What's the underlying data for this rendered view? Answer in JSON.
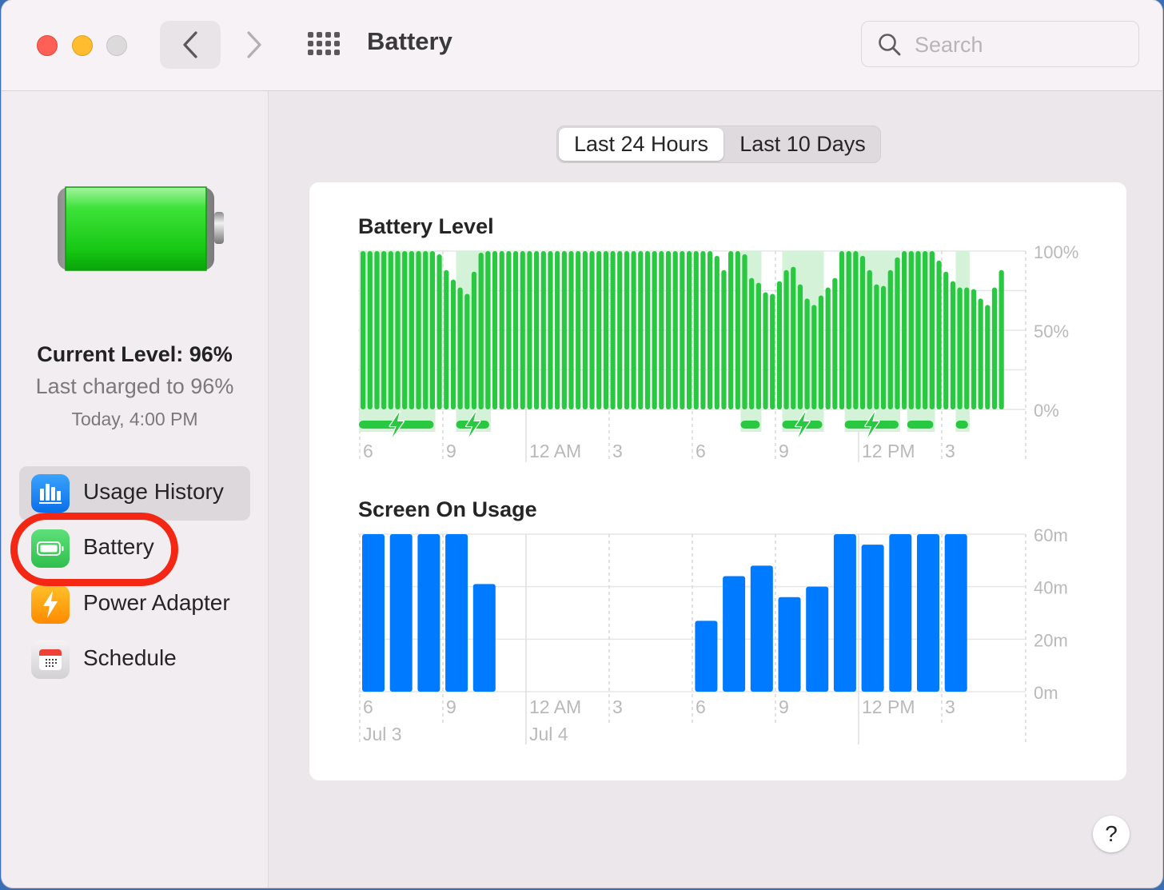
{
  "window": {
    "title": "Battery",
    "search_placeholder": "Search",
    "traffic_lights": [
      "close",
      "minimize",
      "zoom-disabled"
    ]
  },
  "sidebar": {
    "current_level": "Current Level: 96%",
    "last_charged": "Last charged to 96%",
    "charged_time": "Today, 4:00 PM",
    "battery_fill_percent": 96,
    "items": [
      {
        "label": "Usage History",
        "icon": "bar-chart-icon",
        "color": "#1a8cff",
        "selected": true
      },
      {
        "label": "Battery",
        "icon": "battery-icon",
        "color": "#34c759",
        "selected": false
      },
      {
        "label": "Power Adapter",
        "icon": "lightning-bolt-icon",
        "color": "#ff9f0a",
        "selected": false
      },
      {
        "label": "Schedule",
        "icon": "calendar-icon",
        "color": "#e8e6e8",
        "selected": false
      }
    ]
  },
  "tabs": [
    {
      "label": "Last 24 Hours",
      "active": true
    },
    {
      "label": "Last 10 Days",
      "active": false
    }
  ],
  "help_label": "?",
  "colors": {
    "battery_green": "#28c840",
    "charge_band": "#d4f2d8",
    "usage_blue": "#007aff",
    "annotation_red": "#f32714"
  },
  "chart_data": [
    {
      "type": "bar",
      "title": "Battery Level",
      "ylabel": "",
      "xlabel": "",
      "ylim": [
        0,
        100
      ],
      "yticks": [
        "100%",
        "50%",
        "0%"
      ],
      "xtick_labels": [
        "6",
        "9",
        "12 AM",
        "3",
        "6",
        "9",
        "12 PM",
        "3"
      ],
      "interval": "15 min",
      "values": [
        100,
        100,
        100,
        100,
        100,
        100,
        100,
        100,
        100,
        100,
        100,
        98,
        88,
        82,
        77,
        73,
        87,
        99,
        100,
        100,
        100,
        100,
        100,
        100,
        100,
        100,
        100,
        100,
        100,
        100,
        100,
        100,
        100,
        100,
        100,
        100,
        100,
        100,
        100,
        100,
        100,
        100,
        100,
        100,
        100,
        100,
        100,
        100,
        100,
        100,
        100,
        97,
        88,
        100,
        100,
        98,
        83,
        80,
        74,
        73,
        81,
        88,
        90,
        79,
        70,
        66,
        72,
        77,
        83,
        100,
        100,
        100,
        97,
        88,
        79,
        78,
        88,
        96,
        100,
        100,
        100,
        100,
        100,
        94,
        87,
        81,
        77,
        77,
        76,
        70,
        66,
        77,
        88
      ],
      "charging_periods": [
        {
          "start_index": 0,
          "end_index": 10,
          "bolt": true
        },
        {
          "start_index": 14,
          "end_index": 18,
          "bolt": true
        },
        {
          "start_index": 55,
          "end_index": 57,
          "bolt": false
        },
        {
          "start_index": 61,
          "end_index": 66,
          "bolt": true
        },
        {
          "start_index": 70,
          "end_index": 77,
          "bolt": true
        },
        {
          "start_index": 79,
          "end_index": 82,
          "bolt": false
        },
        {
          "start_index": 86,
          "end_index": 87,
          "bolt": false
        }
      ]
    },
    {
      "type": "bar",
      "title": "Screen On Usage",
      "ylabel": "",
      "xlabel": "",
      "ylim": [
        0,
        60
      ],
      "yticks": [
        "60m",
        "40m",
        "20m",
        "0m"
      ],
      "xtick_labels": [
        "6",
        "9",
        "12 AM",
        "3",
        "6",
        "9",
        "12 PM",
        "3"
      ],
      "date_labels": [
        "Jul 3",
        "Jul 4"
      ],
      "interval": "1 hour",
      "values": [
        60,
        60,
        60,
        60,
        41,
        0,
        0,
        0,
        0,
        0,
        0,
        0,
        27,
        44,
        48,
        36,
        40,
        60,
        56,
        60,
        60,
        60
      ]
    }
  ]
}
